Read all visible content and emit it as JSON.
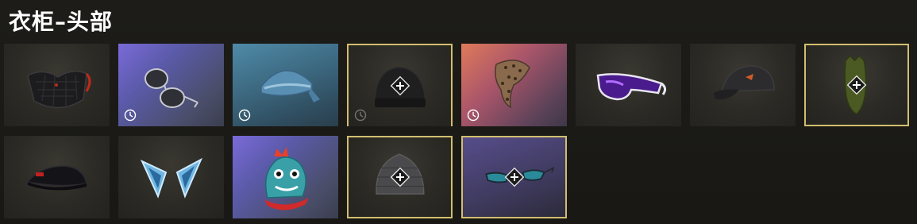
{
  "header": {
    "title": "衣柜–头部"
  },
  "icons": {
    "trial": "clock-icon",
    "equip": "plus-diamond-icon"
  },
  "colors": {
    "selected_border": "#d2be6e",
    "background": "#1a1915"
  },
  "rows": [
    [
      {
        "item": "quilted-face-mask",
        "trial": false,
        "equipped": false
      },
      {
        "item": "aviator-sunglasses",
        "trial": true,
        "equipped": false
      },
      {
        "item": "blue-bandana-cap",
        "trial": true,
        "equipped": false
      },
      {
        "item": "dark-beanie",
        "trial": true,
        "equipped": true
      },
      {
        "item": "leopard-headscarf",
        "trial": true,
        "equipped": false
      },
      {
        "item": "purple-sport-glasses",
        "trial": false,
        "equipped": false
      },
      {
        "item": "dark-baseball-cap",
        "trial": false,
        "equipped": false
      },
      {
        "item": "green-balaclava",
        "trial": false,
        "equipped": true
      }
    ],
    [
      {
        "item": "black-flat-cap",
        "trial": false,
        "equipped": false
      },
      {
        "item": "blue-cat-ears",
        "trial": false,
        "equipped": false
      },
      {
        "item": "dino-mask",
        "trial": false,
        "equipped": false
      },
      {
        "item": "grey-knit-beanie",
        "trial": false,
        "equipped": true
      },
      {
        "item": "tinted-glasses",
        "trial": false,
        "equipped": true
      }
    ]
  ]
}
